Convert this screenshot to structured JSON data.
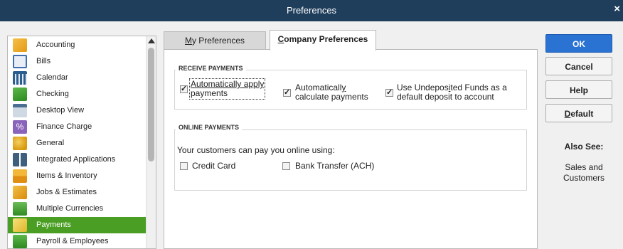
{
  "window": {
    "title": "Preferences",
    "close_glyph": "×"
  },
  "categories": [
    {
      "label": "Accounting",
      "icon": "accounting-icon",
      "color": "#e8a31b"
    },
    {
      "label": "Bills",
      "icon": "bills-icon",
      "color": "#3f6fb0"
    },
    {
      "label": "Calendar",
      "icon": "calendar-icon",
      "color": "#2c5d8f"
    },
    {
      "label": "Checking",
      "icon": "checking-icon",
      "color": "#3e9b2d"
    },
    {
      "label": "Desktop View",
      "icon": "desktop-view-icon",
      "color": "#4b6e93"
    },
    {
      "label": "Finance Charge",
      "icon": "finance-charge-icon",
      "color": "#8057b0"
    },
    {
      "label": "General",
      "icon": "general-icon",
      "color": "#e7b01f"
    },
    {
      "label": "Integrated Applications",
      "icon": "integrated-applications-icon",
      "color": "#3f5f7f"
    },
    {
      "label": "Items & Inventory",
      "icon": "items-inventory-icon",
      "color": "#e6a11a"
    },
    {
      "label": "Jobs & Estimates",
      "icon": "jobs-estimates-icon",
      "color": "#e2a21f"
    },
    {
      "label": "Multiple Currencies",
      "icon": "multiple-currencies-icon",
      "color": "#3e9b2d"
    },
    {
      "label": "Payments",
      "icon": "payments-icon",
      "color": "#f0ce4a"
    },
    {
      "label": "Payroll & Employees",
      "icon": "payroll-employees-icon",
      "color": "#3e9b2d"
    }
  ],
  "selected_category": "Payments",
  "tabs": [
    {
      "label": "My Preferences",
      "mnemonic": "M",
      "rest": "y Preferences",
      "active": false
    },
    {
      "label": "Company Preferences",
      "mnemonic": "C",
      "rest": "ompany Preferences",
      "active": true
    }
  ],
  "receive": {
    "title": "RECEIVE PAYMENTS",
    "auto_apply": {
      "line1": "Automatically apply",
      "line2": "payments",
      "checked": true
    },
    "auto_calc": {
      "line1_a": "Automaticall",
      "line1_u": "y",
      "line2": "calculate payments",
      "checked": true
    },
    "undeposited": {
      "line1_a": "Use Undepos",
      "line1_u": "i",
      "line1_b": "ted Funds as a",
      "line2": "default deposit to account",
      "checked": true
    }
  },
  "online": {
    "title": "ONLINE PAYMENTS",
    "intro": "Your customers can pay you online using:",
    "credit_card": {
      "label": "Credit Card",
      "checked": false
    },
    "bank_transfer": {
      "label": "Bank Transfer (ACH)",
      "checked": false
    }
  },
  "buttons": {
    "ok": "OK",
    "cancel": "Cancel",
    "help": "Help",
    "default_mnemonic": "D",
    "default_rest": "efault"
  },
  "also_see": {
    "title": "Also See:",
    "link_line1": "Sales and",
    "link_line2": "Customers"
  },
  "colors": {
    "titlebar": "#1f3e5c",
    "selected": "#4a9e23",
    "ok_button": "#2b73d2"
  }
}
